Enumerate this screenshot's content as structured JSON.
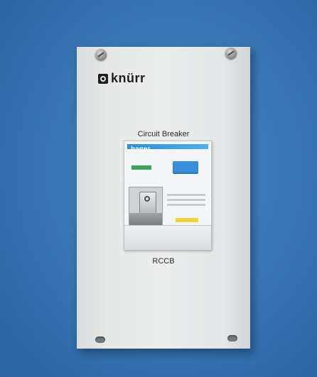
{
  "panel": {
    "logo_text": "knürr",
    "caption_top": "Circuit Breaker",
    "caption_bottom": "RCCB"
  },
  "breaker": {
    "brand": "hager"
  },
  "colors": {
    "background": "#3a76b4",
    "panel": "#e6e8e8",
    "brand_blue": "#2c8fd6",
    "test_button": "#3a8fd8",
    "indicator_green": "#3fa25a",
    "yellow_tab": "#f0d53a"
  }
}
